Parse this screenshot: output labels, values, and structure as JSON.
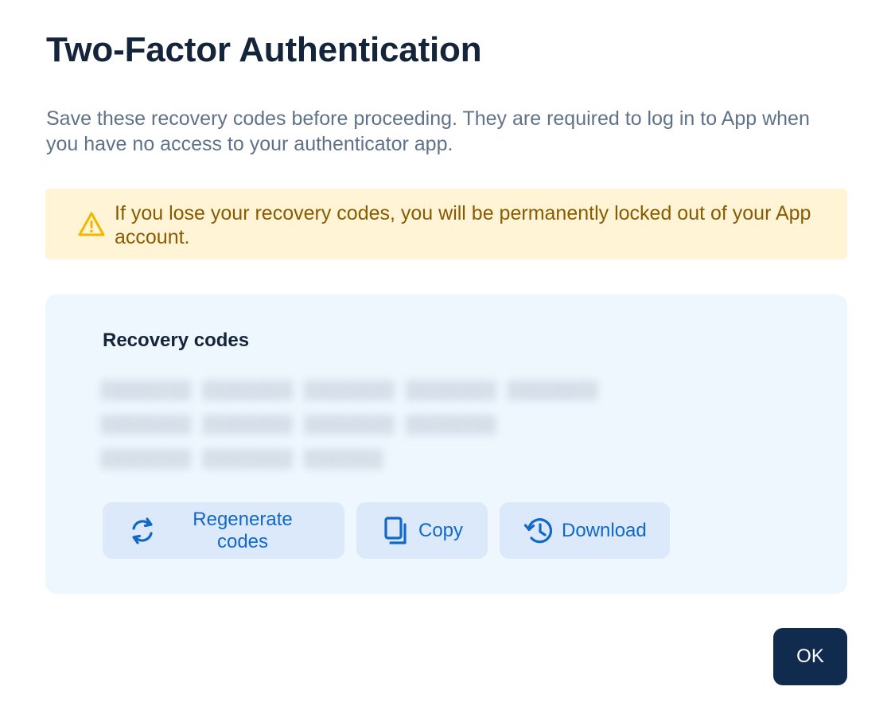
{
  "dialog": {
    "title": "Two-Factor Authentication",
    "description": "Save these recovery codes before proceeding. They are required to log in to App when you have no access to your authenticator app.",
    "warning": {
      "icon": "warning-triangle-icon",
      "text": "If you lose your recovery codes, you will be permanently locked out of your App account.",
      "color": "#8a5a00",
      "background": "#fff5d6"
    },
    "recovery": {
      "heading": "Recovery codes",
      "codes_lines": [
        "",
        "",
        ""
      ],
      "buttons": {
        "regenerate": {
          "label": "Regenerate codes",
          "icon": "refresh-icon"
        },
        "copy": {
          "label": "Copy",
          "icon": "copy-icon"
        },
        "download": {
          "label": "Download",
          "icon": "history-icon"
        }
      }
    },
    "ok_label": "OK"
  },
  "colors": {
    "accent": "#1268c8",
    "primary_button": "#102b4e",
    "panel_background": "#eef6fe",
    "secondary_button": "#dbe9fb"
  }
}
